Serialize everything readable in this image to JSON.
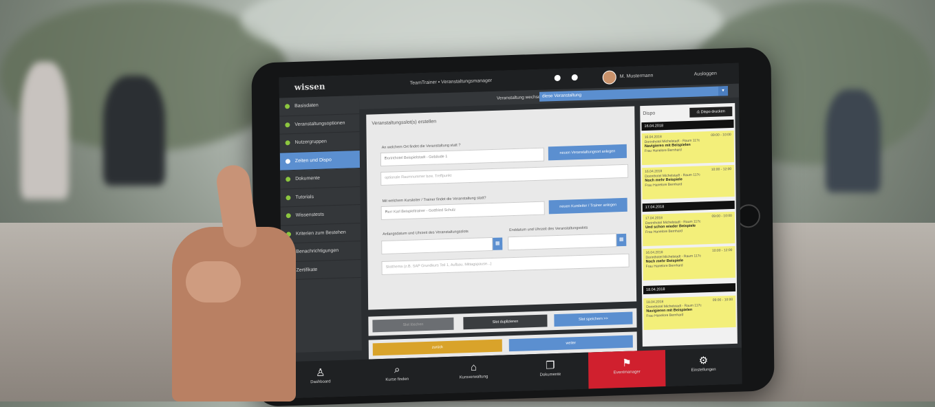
{
  "colors": {
    "accent": "#5b8fd0",
    "success": "#8cc63f",
    "danger": "#d0202e",
    "warning": "#d9a32a",
    "card": "#f3ef7a"
  },
  "header": {
    "logo": "wissen",
    "breadcrumb": "TeamTrainer ▪ Veranstaltungsmanager",
    "user": "M. Mustermann",
    "logout": "Ausloggen"
  },
  "sidebar": {
    "items": [
      {
        "label": "Basisdaten"
      },
      {
        "label": "Veranstaltungsoptionen"
      },
      {
        "label": "Nutzergruppen"
      },
      {
        "label": "Zeiten und Dispo"
      },
      {
        "label": "Dokumente"
      },
      {
        "label": "Tutorials"
      },
      {
        "label": "Wissenstests"
      },
      {
        "label": "Kriterien zum Bestehen"
      },
      {
        "label": "Benachrichtigungen"
      },
      {
        "label": "Zertifikate"
      }
    ]
  },
  "event_switch": {
    "label": "Veranstaltung wechseln:",
    "value": "diese Veranstaltung"
  },
  "form": {
    "title": "Veranstaltungsslot(s) erstellen",
    "location_label": "An welchem Ort findet die Veranstaltung statt ?",
    "location_value": "Dorinthotel Beispielstadt - Gebäude 1",
    "location_button": "neuen Veranstaltungsort anlegen",
    "room_placeholder": "optionale Raumnummer bzw. Treffpunkt",
    "trainer_label": "Mit welchem Kursleiter / Trainer findet die Veranstaltung statt?",
    "trainer_value": "Herr Karl Beispieltrainer - Gottfried Schulz",
    "trainer_button": "neuen Kursleiter / Trainer anlegen",
    "start_label": "Anfangsdatum und Uhrzeit des Veranstaltungsslots",
    "end_label": "Enddatum und Uhrzeit des Veranstaltungsslots",
    "topic_placeholder": "Slotthema (z.B. SAP Grundkurs Teil 1, Aufbau, Mittagspause...)"
  },
  "slot_buttons": {
    "delete": "Slot löschen",
    "duplicate": "Slot duplizieren",
    "save": "Slot speichern >>"
  },
  "nav_buttons": {
    "back": "zurück",
    "next": "weiter"
  },
  "dispo": {
    "title": "Dispo",
    "print": "Dispo drucken",
    "groups": [
      {
        "date": "16.04.2018",
        "cards": [
          {
            "date": "16.04.2018",
            "time": "09:00 - 10:00",
            "place": "Dorinthotel Michelstadt - Raum 117c",
            "title": "Navigieren mit Beispielen",
            "person": "Frau Hanelore Bernhard"
          },
          {
            "date": "16.04.2018",
            "time": "10:00 - 12:00",
            "place": "Dorinthotel Michelstadt - Raum 117c",
            "title": "Noch mehr Beispiele",
            "person": "Frau Hanelore Bernhard"
          }
        ]
      },
      {
        "date": "17.04.2018",
        "cards": [
          {
            "date": "17.04.2018",
            "time": "09:00 - 10:00",
            "place": "Dorinthotel Michelstadt - Raum 117c",
            "title": "Und schon wieder Beispiele",
            "person": "Frau Hanelore Bernhard"
          },
          {
            "date": "16.04.2018",
            "time": "10:00 - 12:00",
            "place": "Dorinthotel Michelstadt - Raum 117c",
            "title": "Noch mehr Beispiele",
            "person": "Frau Hanelore Bernhard"
          }
        ]
      },
      {
        "date": "18.04.2018",
        "cards": [
          {
            "date": "18.04.2018",
            "time": "09:00 - 10:00",
            "place": "Dorinthotel Michelstadt - Raum 117c",
            "title": "Navigieren mit Beispielen",
            "person": "Frau Hanelore Bernhard"
          }
        ]
      }
    ]
  },
  "bottom_nav": [
    {
      "label": "Dashboard",
      "icon": "person-icon"
    },
    {
      "label": "Kurse finden",
      "icon": "search-icon"
    },
    {
      "label": "Kursverwaltung",
      "icon": "bank-icon"
    },
    {
      "label": "Dokumente",
      "icon": "documents-icon"
    },
    {
      "label": "Eventmanager",
      "icon": "sitemap-icon"
    },
    {
      "label": "Einstellungen",
      "icon": "gears-icon"
    }
  ]
}
